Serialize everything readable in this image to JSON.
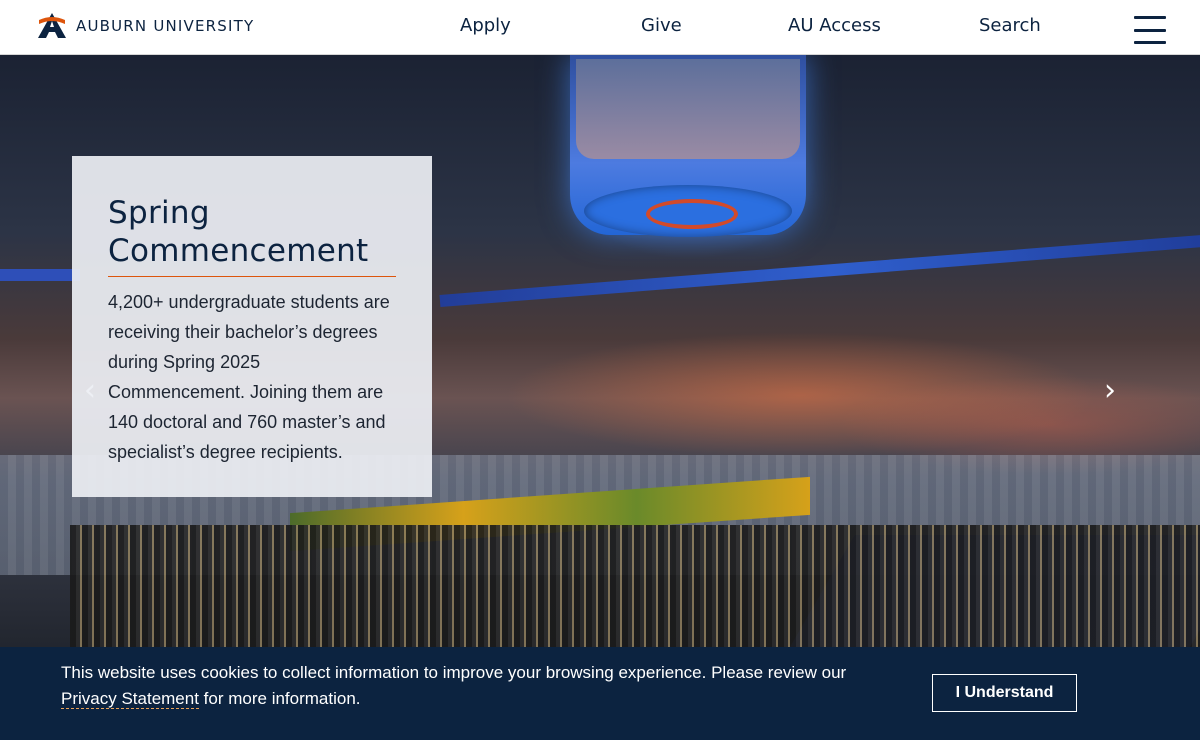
{
  "header": {
    "logo_text": "AUBURN UNIVERSITY",
    "logo_icon": "au-logo-icon",
    "nav": {
      "apply": "Apply",
      "give": "Give",
      "au_access": "AU Access",
      "search": "Search"
    },
    "menu_icon": "hamburger-menu-icon"
  },
  "hero": {
    "title": "Spring Commencement",
    "description": "4,200+ undergraduate students are receiving their bachelor’s degrees during Spring 2025 Commencement. Joining them are 140 doctoral and 760 master’s and specialist’s degree recipients.",
    "prev_icon": "chevron-left-icon",
    "next_icon": "chevron-right-icon",
    "prev_glyph": "‹",
    "next_glyph": "›"
  },
  "cookie": {
    "text_before": "This website uses cookies to collect information to improve your browsing experience. Please review our ",
    "link_text": "Privacy Statement",
    "text_after": " for more information.",
    "button_label": "I Understand"
  },
  "colors": {
    "navy": "#0c2340",
    "orange": "#dd550c",
    "card_bg": "#eceef3"
  }
}
